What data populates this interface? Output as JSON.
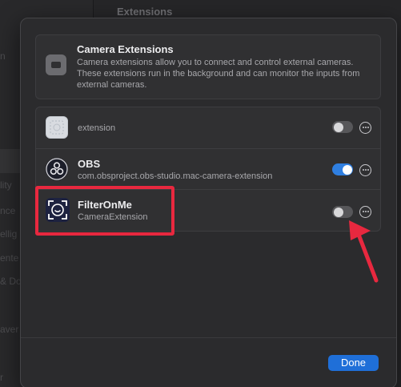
{
  "background": {
    "title": "Extensions",
    "sidebar_fragments": [
      "n",
      "lity",
      "nce",
      "ellig",
      "ente",
      "& Do",
      "aver",
      "r"
    ]
  },
  "info": {
    "title": "Camera Extensions",
    "description": "Camera extensions allow you to connect and control external cameras. These extensions run in the background and can monitor the inputs from external cameras."
  },
  "extensions": [
    {
      "name": "",
      "subtitle": "extension",
      "enabled": false,
      "icon": "placeholder-app-icon"
    },
    {
      "name": "OBS",
      "subtitle": "com.obsproject.obs-studio.mac-camera-extension",
      "enabled": true,
      "icon": "obs-icon"
    },
    {
      "name": "FilterOnMe",
      "subtitle": "CameraExtension",
      "enabled": false,
      "icon": "filteronme-icon"
    }
  ],
  "done_label": "Done",
  "colors": {
    "accent": "#1f6fd8",
    "toggle_on": "#2f7fe1",
    "annotation": "#e8283f"
  }
}
